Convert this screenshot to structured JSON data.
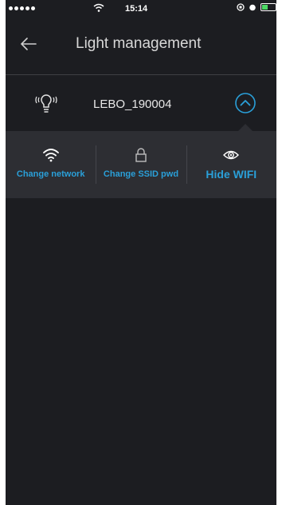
{
  "status_bar": {
    "time": "15:14"
  },
  "header": {
    "title": "Light management"
  },
  "device": {
    "name": "LEBO_190004"
  },
  "actions": [
    {
      "label": "Change network",
      "icon": "wifi-icon"
    },
    {
      "label": "Change SSID pwd",
      "icon": "lock-icon"
    },
    {
      "label": "Hide WIFI",
      "icon": "eye-icon"
    }
  ],
  "colors": {
    "background": "#1c1d21",
    "panel": "#2d2e33",
    "accent": "#2a9fd8"
  }
}
